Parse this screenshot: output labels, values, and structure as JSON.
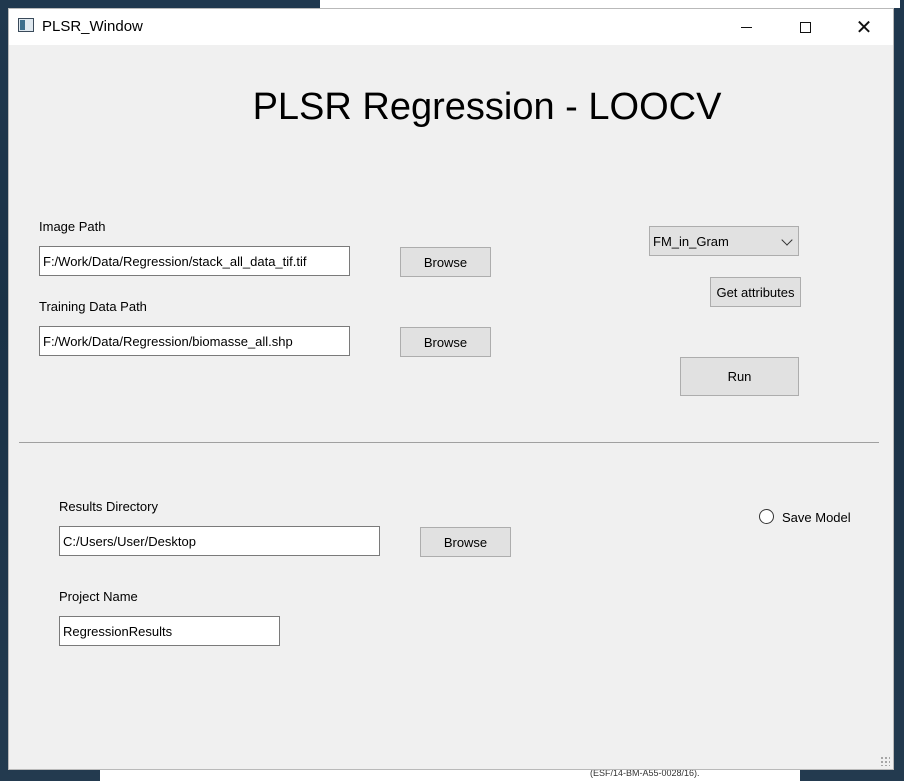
{
  "window": {
    "title": "PLSR_Window"
  },
  "heading": "PLSR Regression - LOOCV",
  "image_path": {
    "label": "Image Path",
    "value": "F:/Work/Data/Regression/stack_all_data_tif.tif",
    "browse_label": "Browse"
  },
  "training_path": {
    "label": "Training Data Path",
    "value": "F:/Work/Data/Regression/biomasse_all.shp",
    "browse_label": "Browse"
  },
  "attribute_select": {
    "selected": "FM_in_Gram"
  },
  "get_attributes_label": "Get attributes",
  "run_label": "Run",
  "results_dir": {
    "label": "Results Directory",
    "value": "C:/Users/User/Desktop",
    "browse_label": "Browse"
  },
  "project_name": {
    "label": "Project Name",
    "value": "RegressionResults"
  },
  "save_model_label": "Save Model",
  "background_doc_text": "(ESF/14-BM-A55-0028/16)."
}
